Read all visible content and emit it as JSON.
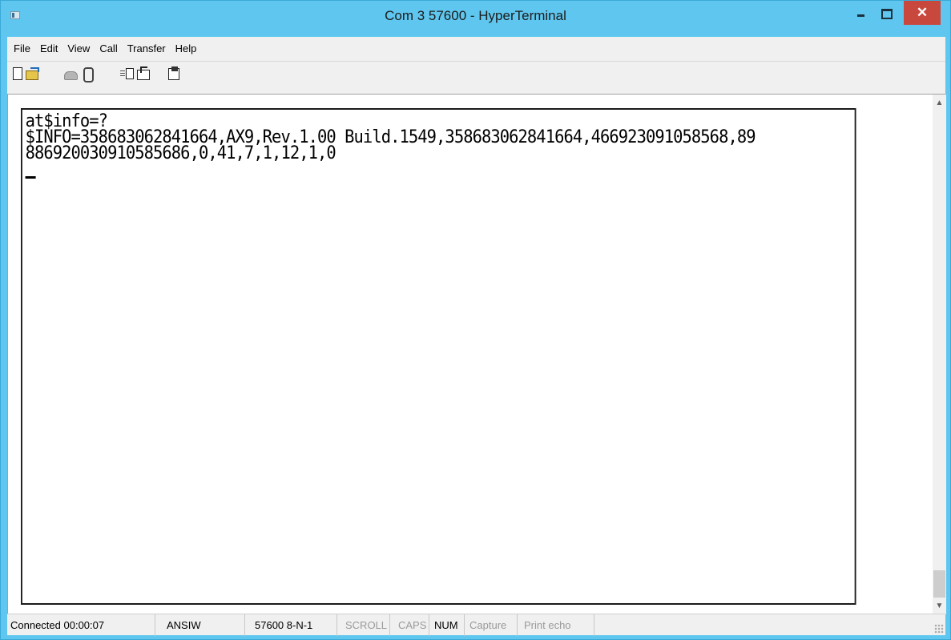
{
  "window": {
    "title": "Com 3 57600 - HyperTerminal"
  },
  "menu": [
    "File",
    "Edit",
    "View",
    "Call",
    "Transfer",
    "Help"
  ],
  "toolbar_icons": [
    "new-icon",
    "open-icon",
    "connect-icon",
    "disconnect-icon",
    "send-icon",
    "receive-icon",
    "properties-icon"
  ],
  "terminal": {
    "lines": [
      "at$info=?",
      "$INFO=358683062841664,AX9,Rev.1.00 Build.1549,358683062841664,466923091058568,89",
      "886920030910585686,0,41,7,1,12,1,0"
    ]
  },
  "status": {
    "connected": "Connected 00:00:07",
    "emulation": "ANSIW",
    "port_settings": "57600 8-N-1",
    "scroll": "SCROLL",
    "caps": "CAPS",
    "num": "NUM",
    "capture": "Capture",
    "print_echo": "Print echo"
  }
}
